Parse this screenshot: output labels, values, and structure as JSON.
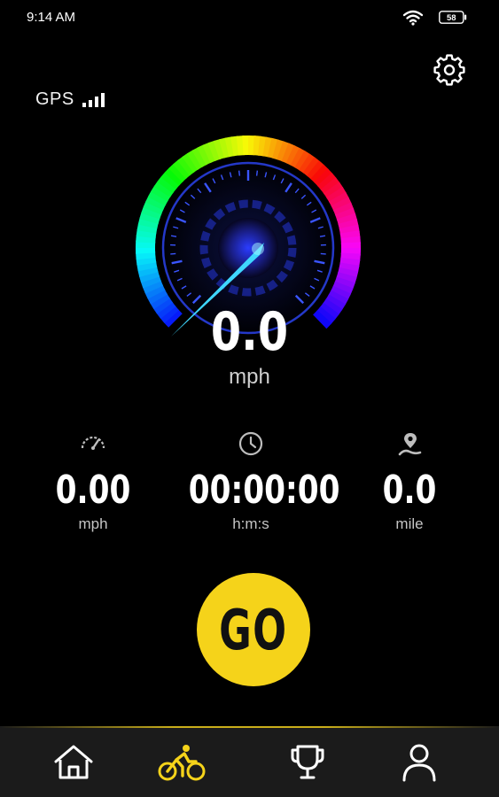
{
  "status_bar": {
    "time": "9:14 AM",
    "battery_level": "58",
    "wifi_icon": "wifi-icon",
    "battery_icon": "battery-icon"
  },
  "header": {
    "gps_label": "GPS",
    "gps_signal_icon": "signal-bars-icon",
    "settings_icon": "gear-icon"
  },
  "speedometer": {
    "speed": "0.0",
    "unit": "mph"
  },
  "stats": [
    {
      "icon": "speedometer-icon",
      "value": "0.00",
      "unit": "mph"
    },
    {
      "icon": "clock-icon",
      "value": "00:00:00",
      "unit": "h:m:s"
    },
    {
      "icon": "location-pin-icon",
      "value": "0.0",
      "unit": "mile"
    }
  ],
  "go_button": {
    "label": "GO",
    "color": "#f5d31a"
  },
  "bottom_nav": {
    "items": [
      {
        "icon": "home-icon",
        "active": false
      },
      {
        "icon": "bicycle-icon",
        "active": true
      },
      {
        "icon": "trophy-icon",
        "active": false
      },
      {
        "icon": "profile-icon",
        "active": false
      }
    ],
    "active_color": "#f5d31a",
    "inactive_color": "#ffffff"
  }
}
